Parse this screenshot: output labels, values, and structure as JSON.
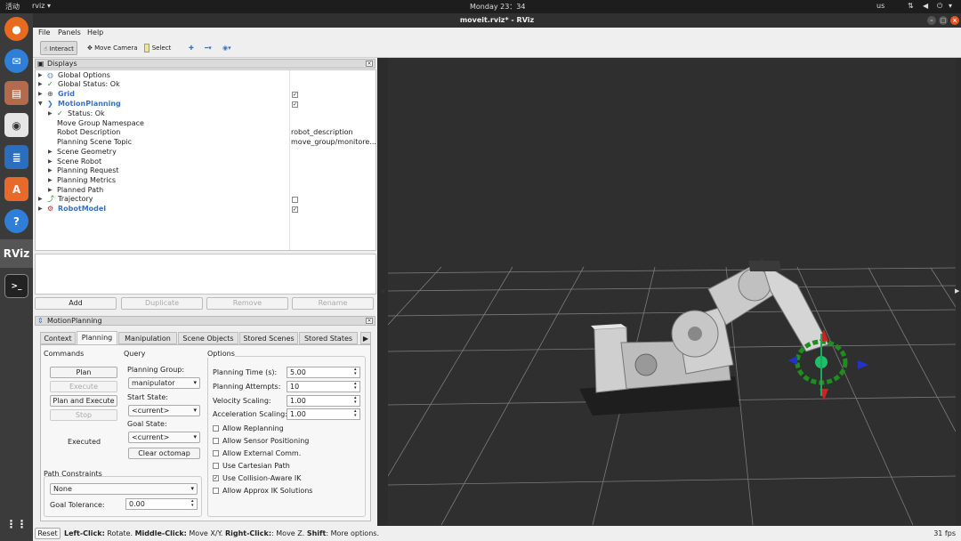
{
  "topbar": {
    "activities": "活动",
    "app": "rviz ▾",
    "clock": "Monday 23：34",
    "lang": "us"
  },
  "window": {
    "title": "moveit.rviz* - RViz"
  },
  "menu": [
    "File",
    "Panels",
    "Help"
  ],
  "toolbar": {
    "interact": "Interact",
    "move_camera": "Move Camera",
    "select": "Select"
  },
  "displays": {
    "header": "Displays",
    "rows": [
      {
        "label": "Global Options",
        "value": ""
      },
      {
        "label": "Global Status: Ok",
        "value": ""
      },
      {
        "label": "Grid",
        "value": "✓"
      },
      {
        "label": "MotionPlanning",
        "value": "✓"
      },
      {
        "label": "Status: Ok",
        "value": ""
      },
      {
        "label": "Move Group Namespace",
        "value": ""
      },
      {
        "label": "Robot Description",
        "value": "robot_description"
      },
      {
        "label": "Planning Scene Topic",
        "value": "move_group/monitore..."
      },
      {
        "label": "Scene Geometry",
        "value": ""
      },
      {
        "label": "Scene Robot",
        "value": ""
      },
      {
        "label": "Planning Request",
        "value": ""
      },
      {
        "label": "Planning Metrics",
        "value": ""
      },
      {
        "label": "Planned Path",
        "value": ""
      },
      {
        "label": "Trajectory",
        "value": ""
      },
      {
        "label": "RobotModel",
        "value": "✓"
      }
    ],
    "buttons": {
      "add": "Add",
      "duplicate": "Duplicate",
      "remove": "Remove",
      "rename": "Rename"
    }
  },
  "motion_planning": {
    "header": "MotionPlanning",
    "tabs": [
      "Context",
      "Planning",
      "Manipulation",
      "Scene Objects",
      "Stored Scenes",
      "Stored States"
    ],
    "commands": {
      "title": "Commands",
      "plan": "Plan",
      "execute": "Execute",
      "plan_execute": "Plan and Execute",
      "stop": "Stop",
      "result": "Executed"
    },
    "query": {
      "title": "Query",
      "planning_group_label": "Planning Group:",
      "planning_group": "manipulator",
      "start_state_label": "Start State:",
      "start_state": "<current>",
      "goal_state_label": "Goal State:",
      "goal_state": "<current>",
      "clear_octomap": "Clear octomap"
    },
    "options": {
      "title": "Options",
      "planning_time_label": "Planning Time (s):",
      "planning_time": "5.00",
      "planning_attempts_label": "Planning Attempts:",
      "planning_attempts": "10",
      "velocity_label": "Velocity Scaling:",
      "velocity": "1.00",
      "accel_label": "Acceleration Scaling:",
      "accel": "1.00",
      "checks": [
        {
          "label": "Allow Replanning",
          "checked": false
        },
        {
          "label": "Allow Sensor Positioning",
          "checked": false
        },
        {
          "label": "Allow External Comm.",
          "checked": false
        },
        {
          "label": "Use Cartesian Path",
          "checked": false
        },
        {
          "label": "Use Collision-Aware IK",
          "checked": true
        },
        {
          "label": "Allow Approx IK Solutions",
          "checked": false
        }
      ]
    },
    "path_constraints": {
      "title": "Path Constraints",
      "value": "None",
      "goal_tol_label": "Goal Tolerance:",
      "goal_tol": "0.00"
    }
  },
  "status": {
    "reset": "Reset",
    "k1": "Left-Click:",
    "v1": " Rotate. ",
    "k2": "Middle-Click:",
    "v2": " Move X/Y. ",
    "k3": "Right-Click:",
    "v3": ": Move Z. ",
    "k4": "Shift",
    "v4": ": More options.",
    "fps": "31 fps"
  },
  "colors": {
    "accent": "#3672c4",
    "viewport_bg": "#2f2f2f",
    "grid": "#8a8a8a"
  }
}
